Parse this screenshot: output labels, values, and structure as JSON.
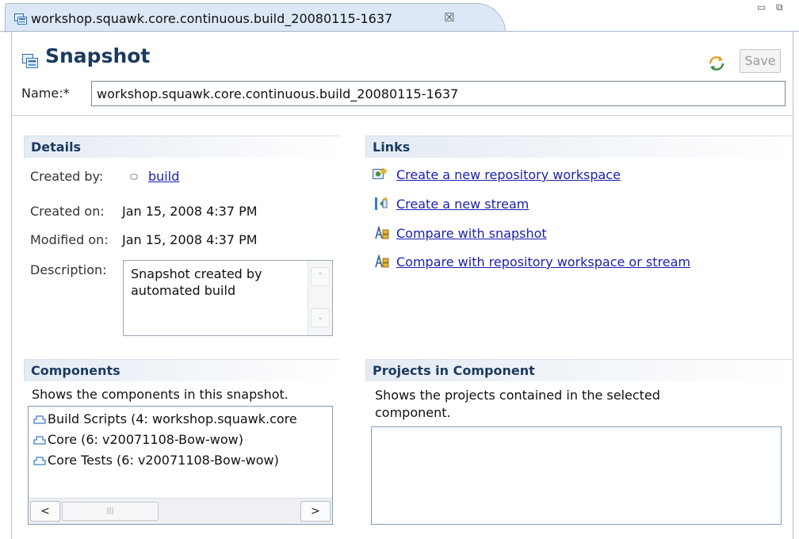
{
  "tab": {
    "title": "workshop.squawk.core.continuous.build_20080115-1637",
    "close": "☒"
  },
  "header": {
    "title": "Snapshot",
    "save_label": "Save",
    "name_label": "Name:*",
    "name_value": "workshop.squawk.core.continuous.build_20080115-1637"
  },
  "details": {
    "title": "Details",
    "created_by_label": "Created by:",
    "created_by_value": "build",
    "created_on_label": "Created on:",
    "created_on_value": "Jan 15, 2008 4:37 PM",
    "modified_on_label": "Modified on:",
    "modified_on_value": "Jan 15, 2008 4:37 PM",
    "description_label": "Description:",
    "description_value": "Snapshot created by automated build"
  },
  "links": {
    "title": "Links",
    "items": [
      {
        "label": "Create a new repository workspace",
        "icon": "repository-workspace-icon"
      },
      {
        "label": "Create a new stream",
        "icon": "stream-icon"
      },
      {
        "label": "Compare with snapshot",
        "icon": "compare-icon"
      },
      {
        "label": "Compare with repository workspace or stream",
        "icon": "compare-icon"
      }
    ]
  },
  "components": {
    "title": "Components",
    "description": "Shows the components in this snapshot.",
    "items": [
      {
        "label": "Build Scripts (4: workshop.squawk.core"
      },
      {
        "label": "Core (6: v20071108-Bow-wow)"
      },
      {
        "label": "Core Tests (6: v20071108-Bow-wow)"
      }
    ]
  },
  "projects": {
    "title": "Projects in Component",
    "description": "Shows the projects contained in the selected component."
  },
  "colors": {
    "link": "#1a1fae",
    "header_text": "#1c3a5f",
    "tab_bg": "#dce8f5",
    "section_bg": "#e4ebf3"
  }
}
